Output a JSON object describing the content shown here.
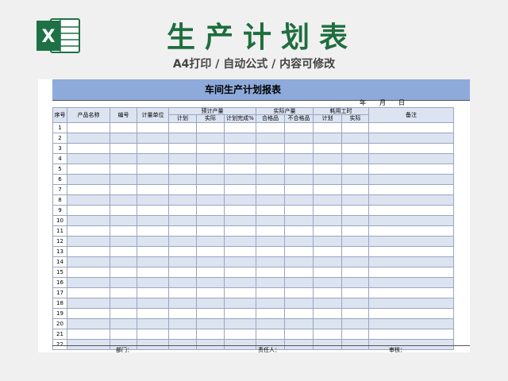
{
  "header": {
    "title": "生产计划表",
    "subtitle": "A4打印 / 自动公式 / 内容可修改",
    "logo_letter": "X",
    "logo_icon": "excel-icon",
    "brand_color": "#1e7145"
  },
  "report": {
    "title": "车间生产计划报表",
    "date_year": "年",
    "date_month": "月",
    "date_day": "日"
  },
  "table": {
    "col_seq": "序号",
    "col_product": "产品名称",
    "col_code": "编号",
    "col_unit": "计量单位",
    "group_expected": "预计产量",
    "group_actual": "实际产量",
    "group_hours": "耗用工时",
    "col_remark": "备注",
    "sub_plan": "计划",
    "sub_actual": "实际",
    "sub_rate": "计划完成%",
    "sub_pass": "合格品",
    "sub_fail": "不合格品",
    "sub_hours_plan": "计划",
    "sub_hours_actual": "实际",
    "rows": [
      "1",
      "2",
      "3",
      "4",
      "5",
      "6",
      "7",
      "8",
      "9",
      "10",
      "11",
      "12",
      "13",
      "14",
      "15",
      "16",
      "17",
      "18",
      "19",
      "20",
      "21",
      "22"
    ]
  },
  "footer": {
    "dept": "部门：",
    "owner": "责任人：",
    "review": "审核："
  }
}
